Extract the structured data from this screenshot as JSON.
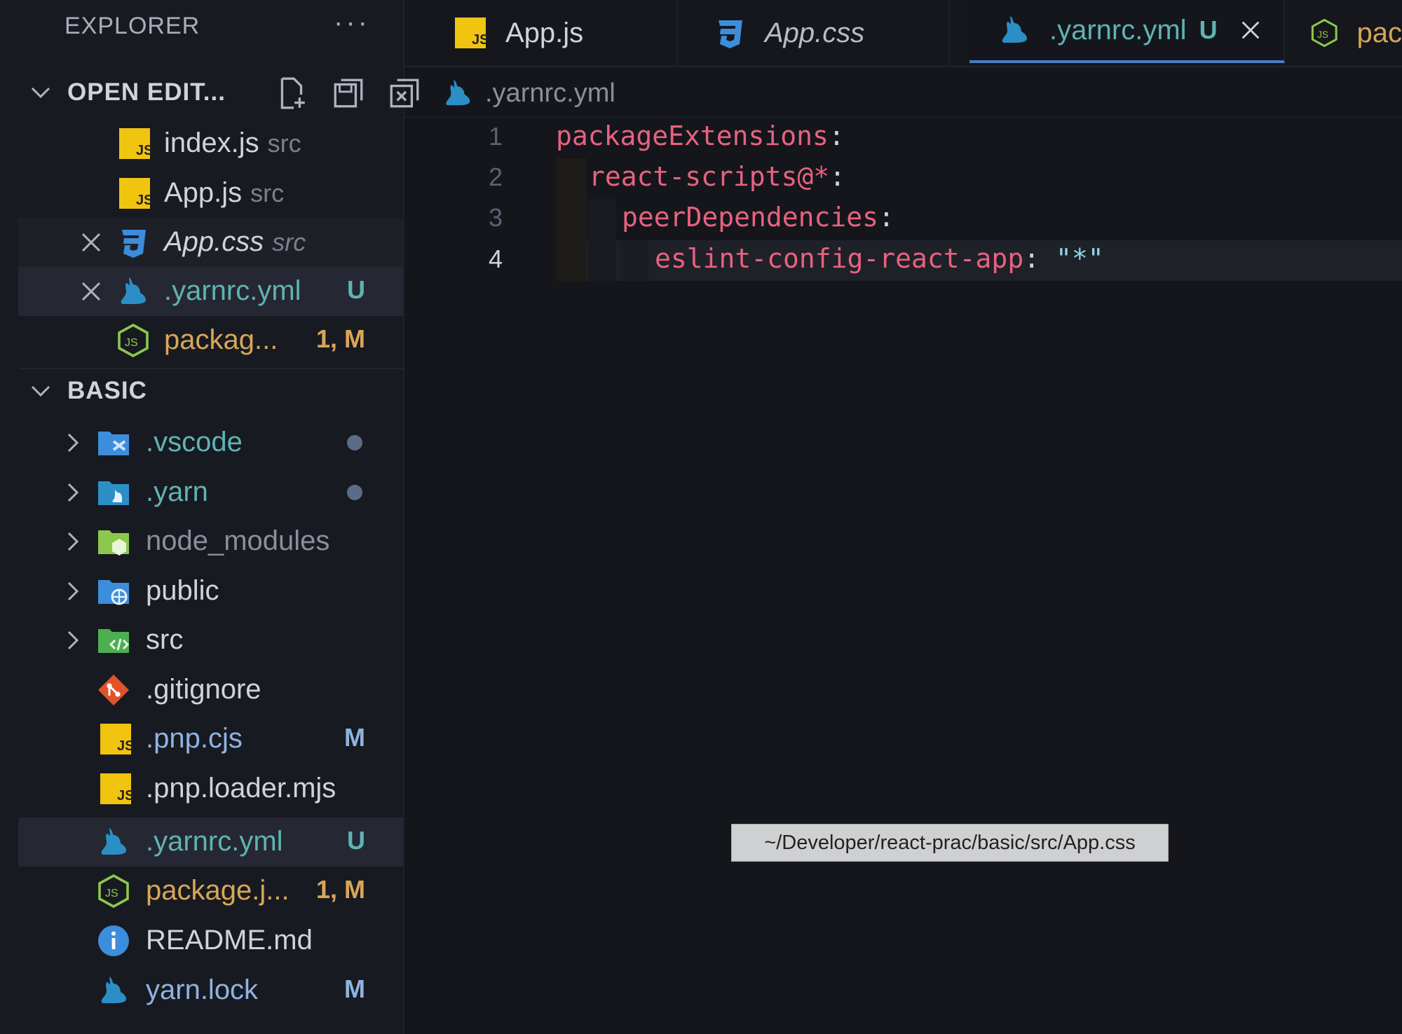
{
  "sidebar": {
    "title": "EXPLORER",
    "more": "···",
    "open_editors": {
      "label": "OPEN EDIT...",
      "items": [
        {
          "name": "index.js",
          "desc": "src"
        },
        {
          "name": "App.js",
          "desc": "src"
        },
        {
          "name": "App.css",
          "desc": "src"
        },
        {
          "name": ".yarnrc.yml",
          "badge": "U"
        },
        {
          "name": "packag...",
          "badge": "1, M"
        }
      ]
    },
    "basic": {
      "label": "BASIC",
      "items": [
        {
          "name": ".vscode"
        },
        {
          "name": ".yarn"
        },
        {
          "name": "node_modules"
        },
        {
          "name": "public"
        },
        {
          "name": "src"
        },
        {
          "name": ".gitignore"
        },
        {
          "name": ".pnp.cjs",
          "badge": "M"
        },
        {
          "name": ".pnp.loader.mjs"
        },
        {
          "name": ".yarnrc.yml",
          "badge": "U"
        },
        {
          "name": "package.j...",
          "badge": "1, M"
        },
        {
          "name": "README.md"
        },
        {
          "name": "yarn.lock",
          "badge": "M"
        }
      ]
    }
  },
  "tabs": [
    {
      "label": "App.js"
    },
    {
      "label": "App.css"
    },
    {
      "label": ".yarnrc.yml",
      "badge": "U"
    },
    {
      "label": "pac"
    }
  ],
  "breadcrumb": ".yarnrc.yml",
  "code": {
    "line_numbers": [
      "1",
      "2",
      "3",
      "4"
    ],
    "lines": [
      {
        "key": "packageExtensions",
        "sep": ":"
      },
      {
        "key": "react-scripts@*",
        "sep": ":"
      },
      {
        "key": "peerDependencies",
        "sep": ":"
      },
      {
        "key": "eslint-config-react-app",
        "sep": ": ",
        "value": "\"*\""
      }
    ]
  },
  "tooltip": "~/Developer/react-prac/basic/src/App.css",
  "colors": {
    "js": "#f1c40f",
    "css": "#3c8ddc",
    "yarn": "#2b8fc6",
    "node": "#8cc84b",
    "git": "#e0532a",
    "untracked": "#5fb3b3",
    "modified": "#d8a657",
    "accent": "#4a7cc7"
  }
}
